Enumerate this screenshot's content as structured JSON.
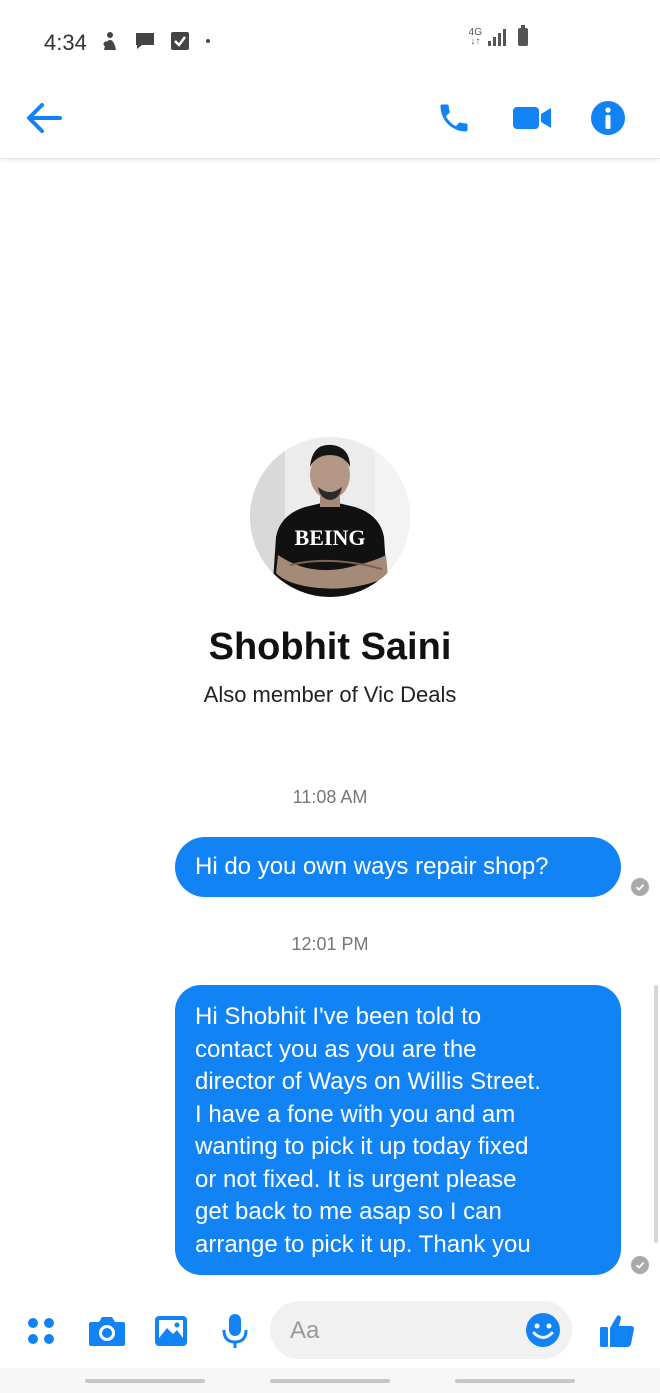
{
  "status_bar": {
    "time": "4:34",
    "network": "4G"
  },
  "header": {
    "back_icon": "arrow-left-icon",
    "actions": [
      "phone-icon",
      "video-camera-icon",
      "info-icon"
    ],
    "accent": "#1283f5"
  },
  "profile": {
    "name": "Shobhit Saini",
    "subtitle": "Also member of Vic Deals",
    "shirt_text": "BEING"
  },
  "conversation": {
    "messages": [
      {
        "timestamp": "11:08 AM",
        "lines": [
          "Hi do you own ways repair shop?"
        ],
        "status": "sent"
      },
      {
        "timestamp": "12:01 PM",
        "lines": [
          "Hi Shobhit I've been told to",
          "contact you as you are the",
          "director of Ways on Willis Street.",
          "I have a fone with you and am",
          "wanting to pick it up today fixed",
          "or not fixed. It is urgent please",
          "get back to me asap so I can",
          "arrange to pick it up. Thank you"
        ],
        "status": "sent"
      }
    ]
  },
  "composer": {
    "placeholder": "Aa",
    "buttons": [
      "apps-icon",
      "camera-icon",
      "gallery-icon",
      "microphone-icon",
      "emoji-icon",
      "thumbs-up-icon"
    ]
  }
}
